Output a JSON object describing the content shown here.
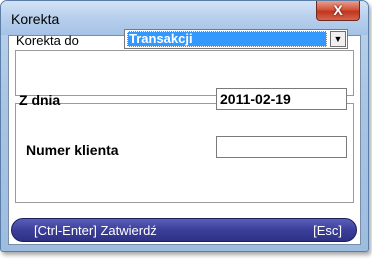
{
  "window": {
    "title": "Korekta",
    "close_label": "X"
  },
  "korekta": {
    "label": "Korekta do",
    "selected": "Transakcji"
  },
  "fields": {
    "date_label": "Z dnia",
    "date_value": "2011-02-19",
    "client_label": "Numer klienta",
    "client_value": ""
  },
  "actions": {
    "confirm_label": "[Ctrl-Enter] Zatwierdź",
    "cancel_label": "[Esc]"
  },
  "colors": {
    "submit_bar": "#3c3f9a",
    "selection": "#3399ff",
    "close_button": "#c0351d"
  }
}
